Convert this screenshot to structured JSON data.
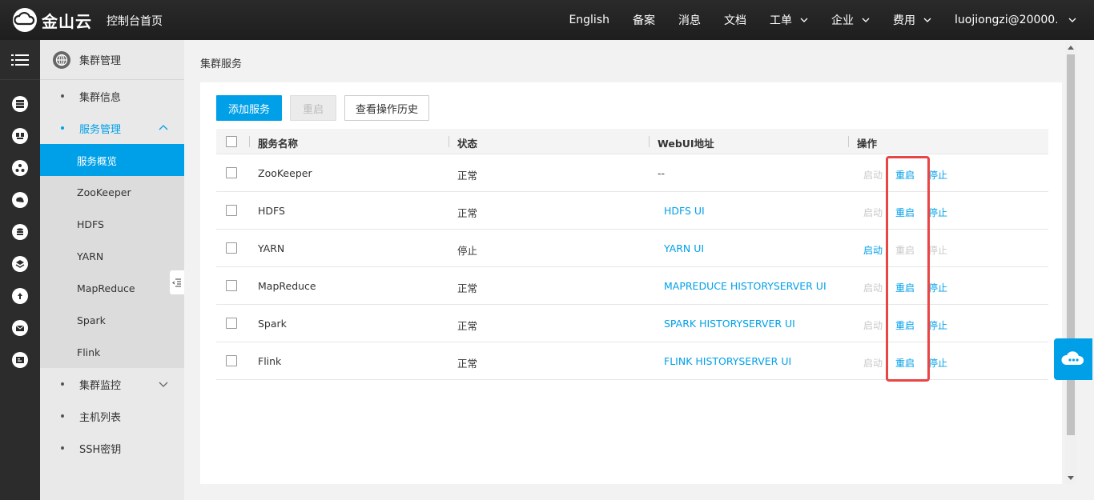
{
  "header": {
    "brand": "金山云",
    "console_home": "控制台首页",
    "nav": [
      {
        "label": "English",
        "has_menu": false
      },
      {
        "label": "备案",
        "has_menu": false
      },
      {
        "label": "消息",
        "has_menu": false
      },
      {
        "label": "文档",
        "has_menu": false
      },
      {
        "label": "工单",
        "has_menu": true
      },
      {
        "label": "企业",
        "has_menu": true
      },
      {
        "label": "费用",
        "has_menu": true
      }
    ],
    "user": "luojiongzi@20000..."
  },
  "sidebar": {
    "title": "集群管理",
    "items": [
      {
        "label": "集群信息"
      },
      {
        "label": "服务管理"
      },
      {
        "label": "集群监控"
      },
      {
        "label": "主机列表"
      },
      {
        "label": "SSH密钥"
      }
    ],
    "sub_items": [
      {
        "label": "服务概览",
        "active": true
      },
      {
        "label": "ZooKeeper"
      },
      {
        "label": "HDFS"
      },
      {
        "label": "YARN"
      },
      {
        "label": "MapReduce"
      },
      {
        "label": "Spark"
      },
      {
        "label": "Flink"
      }
    ]
  },
  "main": {
    "page_title": "集群服务",
    "buttons": {
      "add": "添加服务",
      "restart": "重启",
      "history": "查看操作历史"
    },
    "table": {
      "columns": [
        "服务名称",
        "状态",
        "WebUI地址",
        "操作"
      ],
      "rows": [
        {
          "name": "ZooKeeper",
          "status": "正常",
          "webui": "--",
          "start": "启动",
          "restart": "重启",
          "stop": "停止",
          "start_enabled": false,
          "restart_enabled": true,
          "stop_enabled": true
        },
        {
          "name": "HDFS",
          "status": "正常",
          "webui": "HDFS UI",
          "start": "启动",
          "restart": "重启",
          "stop": "停止",
          "start_enabled": false,
          "restart_enabled": true,
          "stop_enabled": true
        },
        {
          "name": "YARN",
          "status": "停止",
          "webui": "YARN UI",
          "start": "启动",
          "restart": "重启",
          "stop": "停止",
          "start_enabled": true,
          "restart_enabled": false,
          "stop_enabled": false
        },
        {
          "name": "MapReduce",
          "status": "正常",
          "webui": "MAPREDUCE HISTORYSERVER UI",
          "start": "启动",
          "restart": "重启",
          "stop": "停止",
          "start_enabled": false,
          "restart_enabled": true,
          "stop_enabled": true
        },
        {
          "name": "Spark",
          "status": "正常",
          "webui": "SPARK HISTORYSERVER UI",
          "start": "启动",
          "restart": "重启",
          "stop": "停止",
          "start_enabled": false,
          "restart_enabled": true,
          "stop_enabled": true
        },
        {
          "name": "Flink",
          "status": "正常",
          "webui": "FLINK HISTORYSERVER UI",
          "start": "启动",
          "restart": "重启",
          "stop": "停止",
          "start_enabled": false,
          "restart_enabled": true,
          "stop_enabled": true
        }
      ]
    }
  },
  "colors": {
    "accent": "#00a0e9",
    "highlight": "#e84545",
    "topbar": "#222222"
  }
}
